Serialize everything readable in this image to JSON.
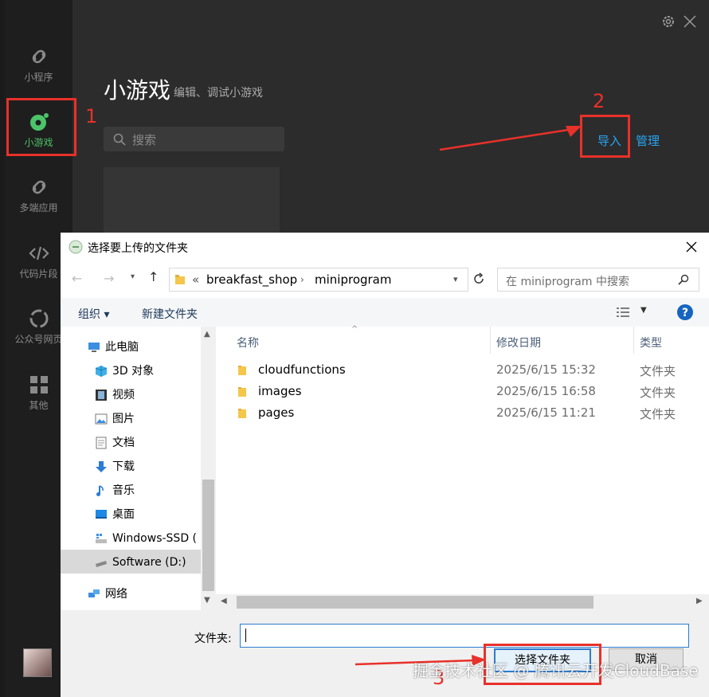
{
  "app": {
    "sidebar": {
      "items": [
        {
          "label": "小程序",
          "icon": "link-icon"
        },
        {
          "label": "小游戏",
          "icon": "game-bubble-icon"
        },
        {
          "label": "多端应用",
          "icon": "link-icon"
        },
        {
          "label": "代码片段",
          "icon": "code-icon"
        },
        {
          "label": "公众号网页",
          "icon": "webpage-icon"
        },
        {
          "label": "其他",
          "icon": "grid-icon"
        }
      ]
    },
    "header": {
      "title": "小游戏",
      "subtitle": "编辑、调试小游戏"
    },
    "search_placeholder": "搜索",
    "actions": {
      "import": "导入",
      "manage": "管理"
    },
    "window_icons": [
      "gear-icon",
      "close-icon"
    ]
  },
  "annotations": {
    "n1": "1",
    "n2": "2",
    "n3": "3"
  },
  "dialog": {
    "title": "选择要上传的文件夹",
    "address": {
      "prefix": "«",
      "segments": [
        "breakfast_shop",
        "miniprogram"
      ]
    },
    "search_placeholder": "在 miniprogram 中搜索",
    "toolbar": {
      "organize": "组织 ▾",
      "new_folder": "新建文件夹"
    },
    "nav": [
      {
        "label": "此电脑",
        "icon": "computer-icon"
      },
      {
        "label": "3D 对象",
        "icon": "cube-icon"
      },
      {
        "label": "视频",
        "icon": "film-icon"
      },
      {
        "label": "图片",
        "icon": "picture-icon"
      },
      {
        "label": "文档",
        "icon": "document-icon"
      },
      {
        "label": "下载",
        "icon": "download-icon"
      },
      {
        "label": "音乐",
        "icon": "music-icon"
      },
      {
        "label": "桌面",
        "icon": "desktop-icon"
      },
      {
        "label": "Windows-SSD (",
        "icon": "drive-icon"
      },
      {
        "label": "Software (D:)",
        "icon": "drive-icon"
      },
      {
        "label": "网络",
        "icon": "network-icon"
      }
    ],
    "columns": {
      "name": "名称",
      "modified": "修改日期",
      "type": "类型"
    },
    "files": [
      {
        "name": "cloudfunctions",
        "modified": "2025/6/15 15:32",
        "type": "文件夹"
      },
      {
        "name": "images",
        "modified": "2025/6/15 16:58",
        "type": "文件夹"
      },
      {
        "name": "pages",
        "modified": "2025/6/15 11:21",
        "type": "文件夹"
      }
    ],
    "folder_label": "文件夹:",
    "folder_value": "",
    "select_button": "选择文件夹",
    "cancel_button": "取消"
  },
  "watermark": "掘金技术社区 @ 腾讯云开发CloudBase",
  "colors": {
    "accent_green": "#4cc46a",
    "link_blue": "#29a3f2",
    "annotation_red": "#e8312a"
  }
}
